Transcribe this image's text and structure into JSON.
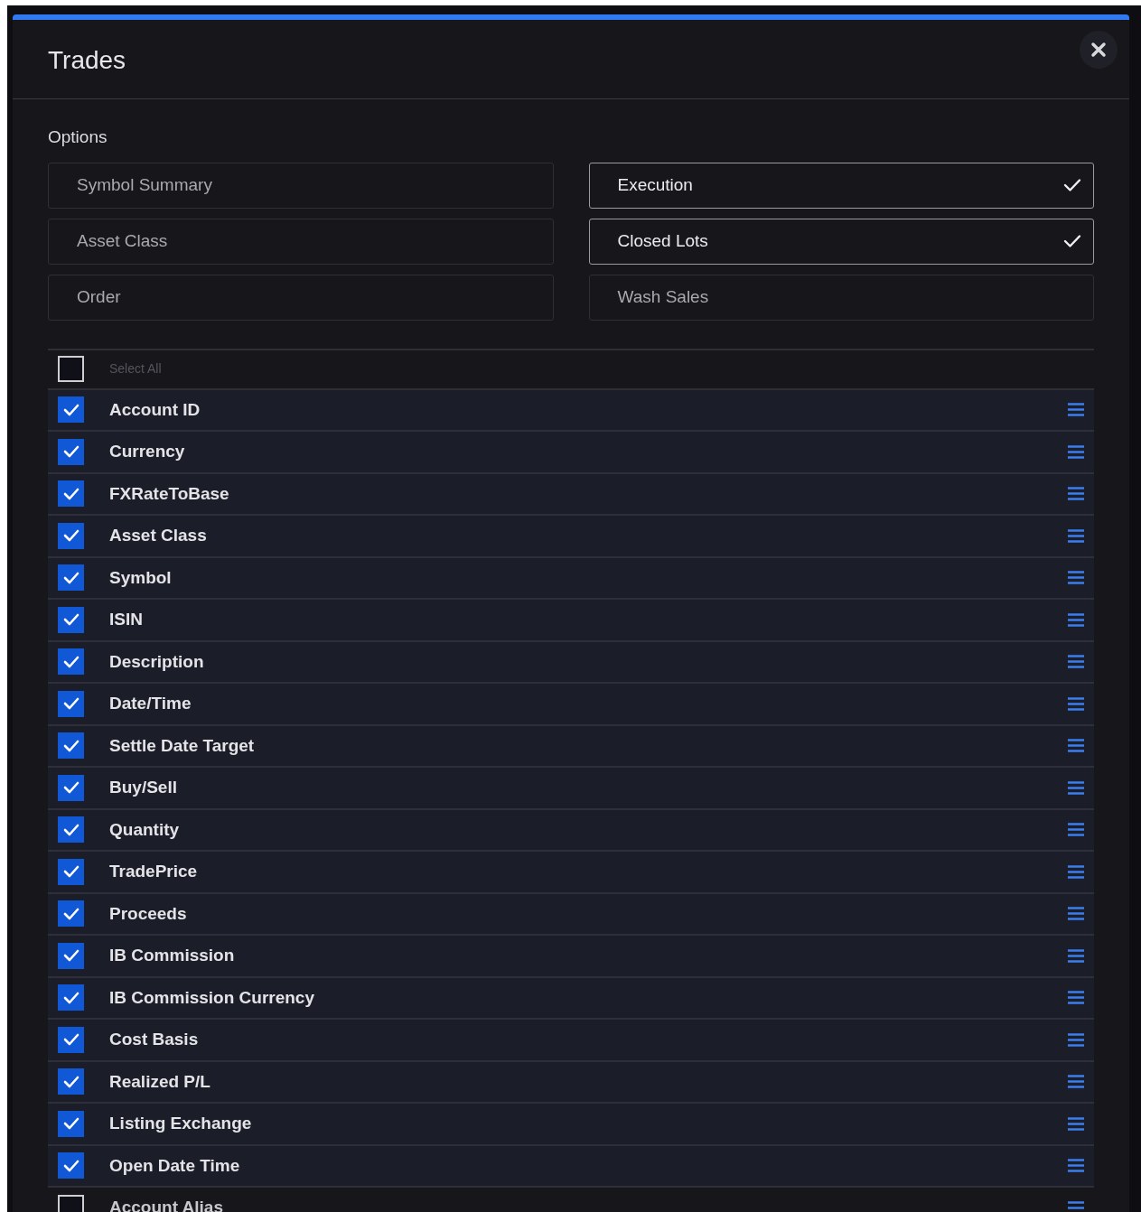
{
  "dialog": {
    "title": "Trades"
  },
  "options": {
    "label": "Options",
    "items": [
      {
        "label": "Symbol Summary",
        "selected": false
      },
      {
        "label": "Execution",
        "selected": true
      },
      {
        "label": "Asset Class",
        "selected": false
      },
      {
        "label": "Closed Lots",
        "selected": true
      },
      {
        "label": "Order",
        "selected": false
      },
      {
        "label": "Wash Sales",
        "selected": false
      }
    ]
  },
  "select_all": {
    "label": "Select All",
    "checked": false
  },
  "fields": [
    {
      "label": "Account ID",
      "checked": true
    },
    {
      "label": "Currency",
      "checked": true
    },
    {
      "label": "FXRateToBase",
      "checked": true
    },
    {
      "label": "Asset Class",
      "checked": true
    },
    {
      "label": "Symbol",
      "checked": true
    },
    {
      "label": "ISIN",
      "checked": true
    },
    {
      "label": "Description",
      "checked": true
    },
    {
      "label": "Date/Time",
      "checked": true
    },
    {
      "label": "Settle Date Target",
      "checked": true
    },
    {
      "label": "Buy/Sell",
      "checked": true
    },
    {
      "label": "Quantity",
      "checked": true
    },
    {
      "label": "TradePrice",
      "checked": true
    },
    {
      "label": "Proceeds",
      "checked": true
    },
    {
      "label": "IB Commission",
      "checked": true
    },
    {
      "label": "IB Commission Currency",
      "checked": true
    },
    {
      "label": "Cost Basis",
      "checked": true
    },
    {
      "label": "Realized P/L",
      "checked": true
    },
    {
      "label": "Listing Exchange",
      "checked": true
    },
    {
      "label": "Open Date Time",
      "checked": true
    },
    {
      "label": "Account Alias",
      "checked": false
    }
  ]
}
